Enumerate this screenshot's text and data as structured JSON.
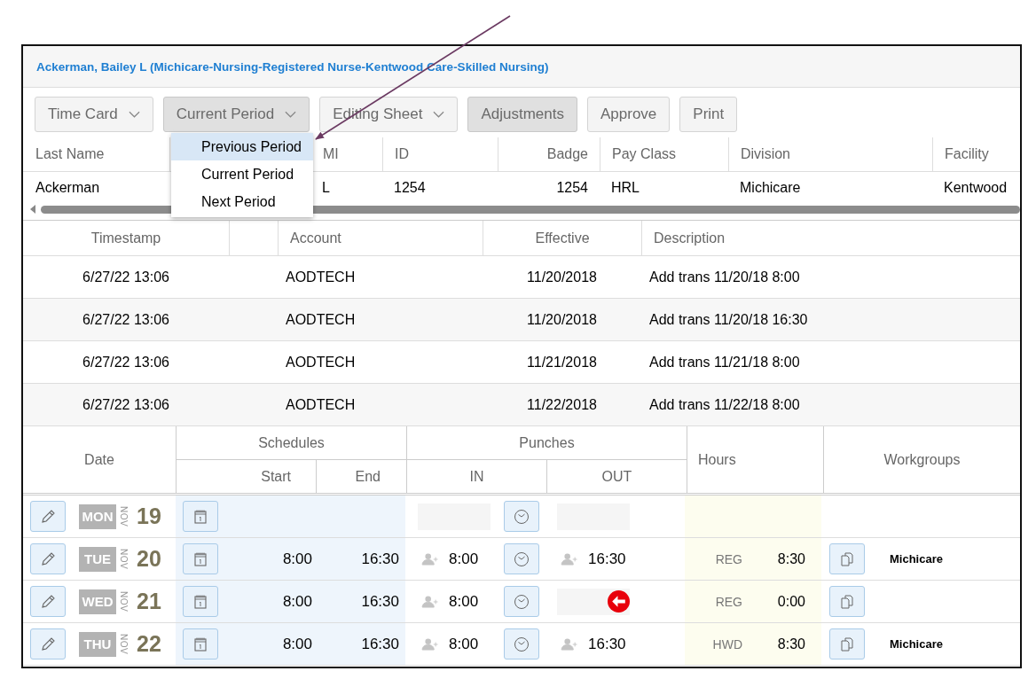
{
  "header": {
    "title": "Ackerman, Bailey L (Michicare-Nursing-Registered Nurse-Kentwood Care-Skilled Nursing)"
  },
  "toolbar": [
    {
      "label": "Time Card",
      "kind": "dropdown",
      "selected": false
    },
    {
      "label": "Current Period",
      "kind": "dropdown",
      "selected": true
    },
    {
      "label": "Editing Sheet",
      "kind": "dropdown",
      "selected": false
    },
    {
      "label": "Adjustments",
      "kind": "button",
      "selected": true
    },
    {
      "label": "Approve",
      "kind": "button",
      "selected": false
    },
    {
      "label": "Print",
      "kind": "button",
      "selected": false
    }
  ],
  "period_menu": [
    {
      "label": "Previous Period",
      "selected": true
    },
    {
      "label": "Current Period",
      "selected": false
    },
    {
      "label": "Next Period",
      "selected": false
    }
  ],
  "employee": {
    "columns": [
      "Last Name",
      "MI",
      "ID",
      "Badge",
      "Pay Class",
      "Division",
      "Facility"
    ],
    "row": [
      "Ackerman",
      "L",
      "1254",
      "1254",
      "HRL",
      "Michicare",
      "Kentwood"
    ]
  },
  "audit": {
    "columns": [
      "Timestamp",
      "Account",
      "Effective",
      "Description"
    ],
    "rows": [
      {
        "timestamp": "6/27/22 13:06",
        "account": "AODTECH",
        "effective": "11/20/2018",
        "description": "Add trans 11/20/18 8:00"
      },
      {
        "timestamp": "6/27/22 13:06",
        "account": "AODTECH",
        "effective": "11/20/2018",
        "description": "Add trans 11/20/18 16:30"
      },
      {
        "timestamp": "6/27/22 13:06",
        "account": "AODTECH",
        "effective": "11/21/2018",
        "description": "Add trans 11/21/18 8:00"
      },
      {
        "timestamp": "6/27/22 13:06",
        "account": "AODTECH",
        "effective": "11/22/2018",
        "description": "Add trans 11/22/18 8:00"
      }
    ]
  },
  "timecard": {
    "headers": {
      "date": "Date",
      "schedules": "Schedules",
      "start": "Start",
      "end": "End",
      "punches": "Punches",
      "in": "IN",
      "out": "OUT",
      "hours": "Hours",
      "workgroups": "Workgroups"
    },
    "rows": [
      {
        "day": "MON",
        "month": "NOV",
        "date": "19",
        "start": "",
        "end": "",
        "in": "",
        "out": "",
        "out_missing": false,
        "hour_code": "",
        "hours": "",
        "workgroup_button": false,
        "workgroup": ""
      },
      {
        "day": "TUE",
        "month": "NOV",
        "date": "20",
        "start": "8:00",
        "end": "16:30",
        "in": "8:00",
        "out": "16:30",
        "out_missing": false,
        "hour_code": "REG",
        "hours": "8:30",
        "workgroup_button": true,
        "workgroup": "Michicare"
      },
      {
        "day": "WED",
        "month": "NOV",
        "date": "21",
        "start": "8:00",
        "end": "16:30",
        "in": "8:00",
        "out": "",
        "out_missing": true,
        "hour_code": "REG",
        "hours": "0:00",
        "workgroup_button": true,
        "workgroup": ""
      },
      {
        "day": "THU",
        "month": "NOV",
        "date": "22",
        "start": "8:00",
        "end": "16:30",
        "in": "8:00",
        "out": "16:30",
        "out_missing": false,
        "hour_code": "HWD",
        "hours": "8:30",
        "workgroup_button": true,
        "workgroup": "Michicare"
      }
    ]
  }
}
